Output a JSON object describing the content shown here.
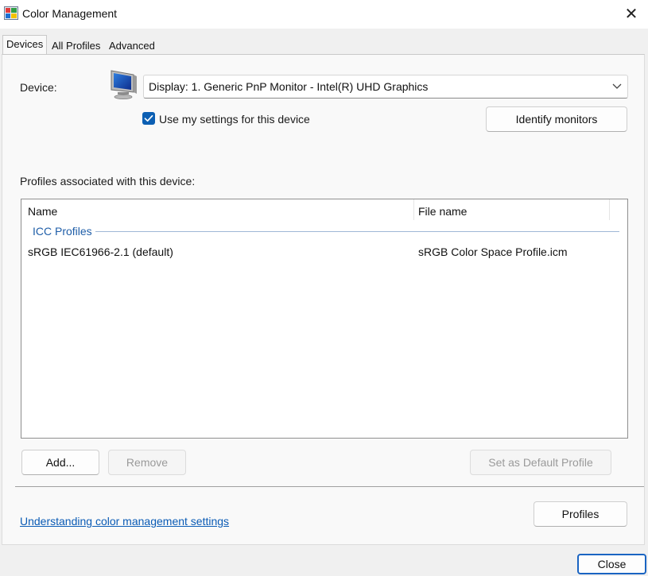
{
  "window": {
    "title": "Color Management",
    "close_glyph": "✕"
  },
  "tabs": [
    {
      "label": "Devices",
      "active": true
    },
    {
      "label": "All Profiles",
      "active": false
    },
    {
      "label": "Advanced",
      "active": false
    }
  ],
  "device": {
    "label": "Device:",
    "selected": "Display: 1. Generic PnP Monitor - Intel(R) UHD Graphics",
    "use_my_settings_label": "Use my settings for this device",
    "use_my_settings_checked": true,
    "identify_button": "Identify monitors"
  },
  "profiles": {
    "section_label": "Profiles associated with this device:",
    "columns": [
      "Name",
      "File name"
    ],
    "group": "ICC Profiles",
    "rows": [
      {
        "name": "sRGB IEC61966-2.1 (default)",
        "file": "sRGB Color Space Profile.icm"
      }
    ]
  },
  "buttons": {
    "add": "Add...",
    "remove": "Remove",
    "set_default": "Set as Default Profile",
    "profiles": "Profiles",
    "close": "Close"
  },
  "link": {
    "text": "Understanding color management settings"
  },
  "colors": {
    "accent": "#0c5fb3",
    "link": "#0a5bb5",
    "group_title": "#1f5ea8"
  },
  "icons": {
    "app": "color-management-icon",
    "device": "monitor-icon",
    "dropdown": "chevron-down-icon",
    "check": "checkmark-icon",
    "close": "close-icon"
  }
}
